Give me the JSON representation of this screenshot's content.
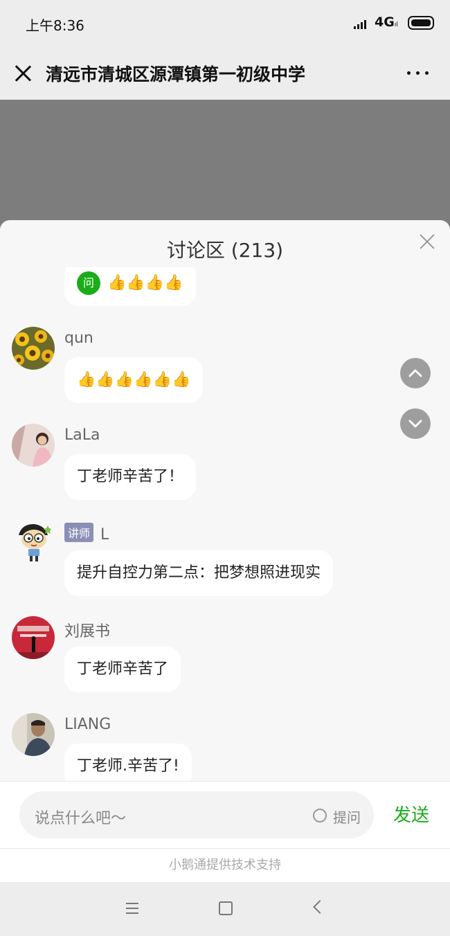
{
  "status_bar": {
    "time": "上午8:36",
    "network": "4G",
    "network_sub": "ıl"
  },
  "header": {
    "title": "清远市清城区源潭镇第一初级中学"
  },
  "discussion": {
    "title": "讨论区 (213)",
    "messages": [
      {
        "user": "",
        "badge": "",
        "text": "👍👍👍👍",
        "question_badge": "问"
      },
      {
        "user": "qun",
        "badge": "",
        "text": "👍👍👍👍👍👍"
      },
      {
        "user": "LaLa",
        "badge": "",
        "text": "丁老师辛苦了！"
      },
      {
        "user": "L",
        "badge": "讲师",
        "text": "提升自控力第二点：把梦想照进现实"
      },
      {
        "user": "刘展书",
        "badge": "",
        "text": "丁老师辛苦了"
      },
      {
        "user": "LIANG",
        "badge": "",
        "text": "丁老师.辛苦了!"
      }
    ]
  },
  "input": {
    "placeholder": "说点什么吧～",
    "ask_label": "提问",
    "send_label": "发送"
  },
  "footer": {
    "text": "小鹅通提供技术支持"
  }
}
